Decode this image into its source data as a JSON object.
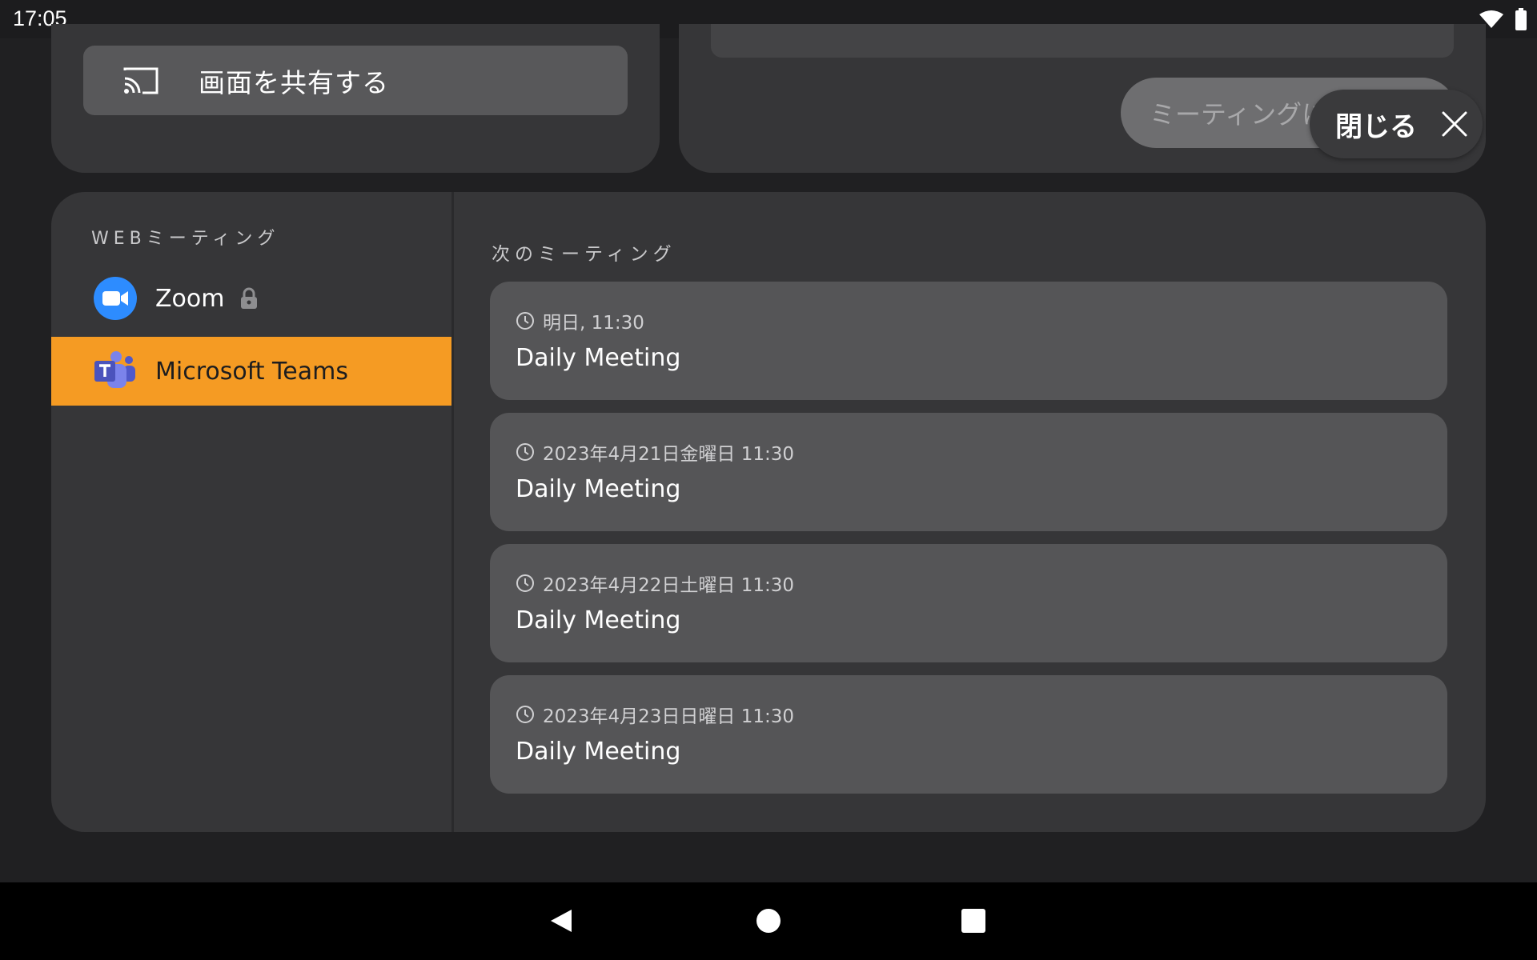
{
  "status_bar": {
    "time": "17:05",
    "icons": [
      "wifi-icon",
      "battery-icon"
    ]
  },
  "share": {
    "label": "画面を共有する",
    "icon": "cast-icon"
  },
  "join": {
    "button_label": "ミーティングに"
  },
  "close_popup": {
    "label": "閉じる",
    "icon": "close-icon"
  },
  "sidebar": {
    "heading": "WEBミーティング",
    "providers": [
      {
        "label": "Zoom",
        "icon": "zoom-logo-icon",
        "locked": true,
        "selected": false
      },
      {
        "label": "Microsoft Teams",
        "icon": "teams-logo-icon",
        "locked": false,
        "selected": true
      }
    ]
  },
  "meetings": {
    "heading": "次のミーティング",
    "items": [
      {
        "when": "明日, 11:30",
        "title": "Daily Meeting"
      },
      {
        "when": "2023年4月21日金曜日 11:30",
        "title": "Daily Meeting"
      },
      {
        "when": "2023年4月22日土曜日 11:30",
        "title": "Daily Meeting"
      },
      {
        "when": "2023年4月23日日曜日 11:30",
        "title": "Daily Meeting"
      }
    ]
  },
  "colors": {
    "background": "#202022",
    "card": "#363638",
    "meeting_card": "#555557",
    "selected_accent": "#f59b23",
    "zoom_blue": "#2d8cff",
    "teams_purple": "#5b5fc7"
  },
  "nav_bar": {
    "icons": [
      "back-icon",
      "home-icon",
      "recents-icon"
    ]
  }
}
